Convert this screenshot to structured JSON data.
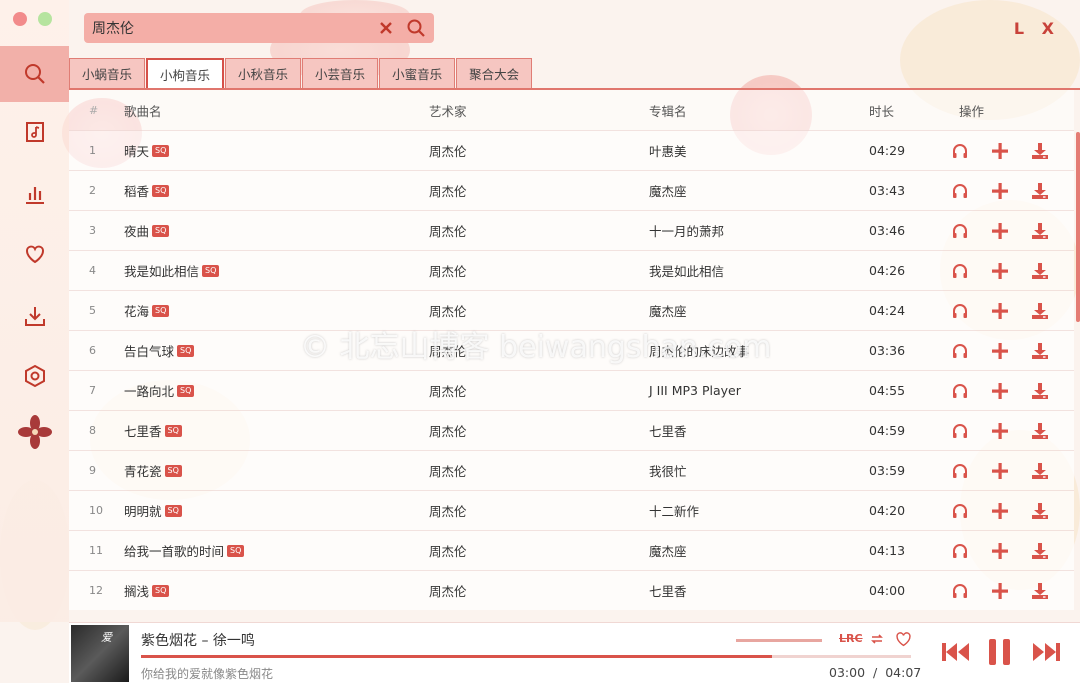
{
  "window": {
    "brand": "L X"
  },
  "search": {
    "value": "周杰伦",
    "placeholder": ""
  },
  "sidebar": {
    "items": [
      {
        "icon": "search-icon",
        "active": true
      },
      {
        "icon": "music-library-icon"
      },
      {
        "icon": "chart-icon"
      },
      {
        "icon": "heart-icon"
      },
      {
        "icon": "download-icon"
      },
      {
        "icon": "settings-icon"
      }
    ]
  },
  "tabs": [
    {
      "label": "小蜗音乐"
    },
    {
      "label": "小枸音乐",
      "active": true
    },
    {
      "label": "小秋音乐"
    },
    {
      "label": "小芸音乐"
    },
    {
      "label": "小蜜音乐"
    },
    {
      "label": "聚合大会"
    }
  ],
  "table": {
    "headers": {
      "num": "#",
      "name": "歌曲名",
      "artist": "艺术家",
      "album": "专辑名",
      "duration": "时长",
      "ops": "操作"
    },
    "quality_badge": "SQ",
    "rows": [
      {
        "num": "1",
        "name": "晴天",
        "artist": "周杰伦",
        "album": "叶惠美",
        "duration": "04:29"
      },
      {
        "num": "2",
        "name": "稻香",
        "artist": "周杰伦",
        "album": "魔杰座",
        "duration": "03:43"
      },
      {
        "num": "3",
        "name": "夜曲",
        "artist": "周杰伦",
        "album": "十一月的萧邦",
        "duration": "03:46"
      },
      {
        "num": "4",
        "name": "我是如此相信",
        "artist": "周杰伦",
        "album": "我是如此相信",
        "duration": "04:26"
      },
      {
        "num": "5",
        "name": "花海",
        "artist": "周杰伦",
        "album": "魔杰座",
        "duration": "04:24"
      },
      {
        "num": "6",
        "name": "告白气球",
        "artist": "周杰伦",
        "album": "周杰伦的床边故事",
        "duration": "03:36"
      },
      {
        "num": "7",
        "name": "一路向北",
        "artist": "周杰伦",
        "album": "J III MP3 Player",
        "duration": "04:55"
      },
      {
        "num": "8",
        "name": "七里香",
        "artist": "周杰伦",
        "album": "七里香",
        "duration": "04:59"
      },
      {
        "num": "9",
        "name": "青花瓷",
        "artist": "周杰伦",
        "album": "我很忙",
        "duration": "03:59"
      },
      {
        "num": "10",
        "name": "明明就",
        "artist": "周杰伦",
        "album": "十二新作",
        "duration": "04:20"
      },
      {
        "num": "11",
        "name": "给我一首歌的时间",
        "artist": "周杰伦",
        "album": "魔杰座",
        "duration": "04:13"
      },
      {
        "num": "12",
        "name": "搁浅",
        "artist": "周杰伦",
        "album": "七里香",
        "duration": "04:00"
      }
    ]
  },
  "watermark": "© 北忘山博客 beiwangshan.com",
  "player": {
    "title": "紫色烟花 – 徐一鸣",
    "lyric": "你给我的爱就像紫色烟花",
    "cover_text": "爱",
    "current_time": "03:00",
    "separator": "/",
    "total_time": "04:07",
    "progress": 0.82,
    "lrc_label": "LRC"
  },
  "colors": {
    "accent": "#d9534a",
    "tab_bg": "#f6c6c1",
    "search_bg": "#f4aea7"
  }
}
